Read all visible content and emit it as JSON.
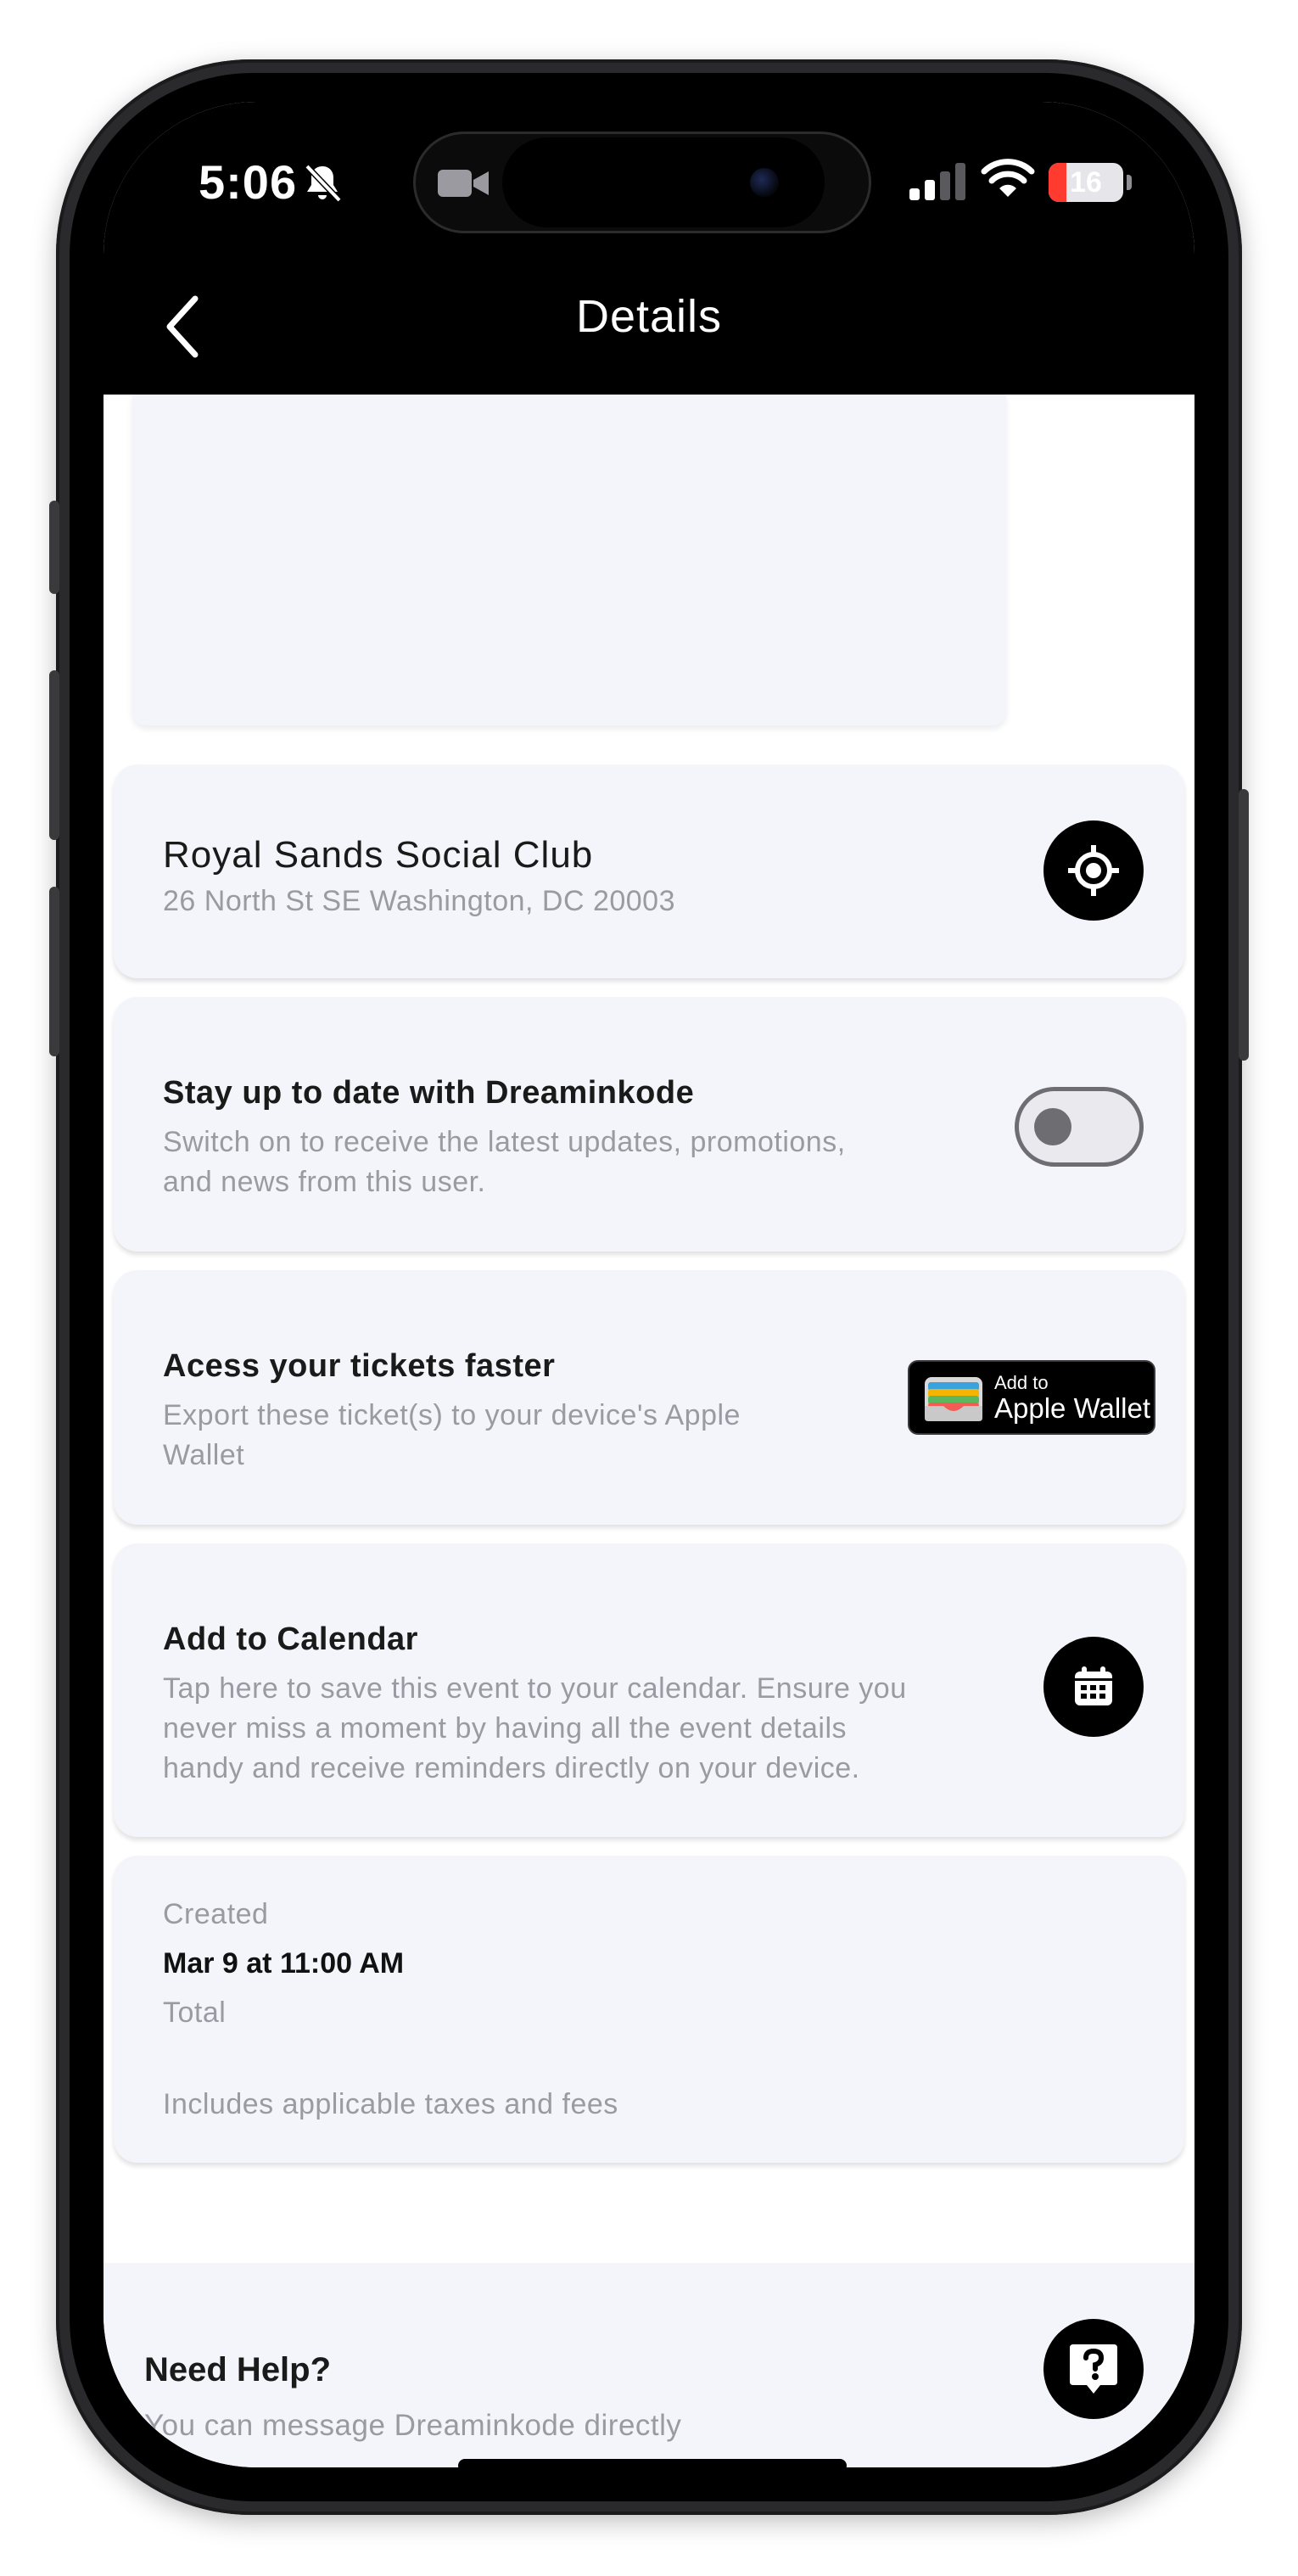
{
  "status_bar": {
    "time": "5:06",
    "battery": "16"
  },
  "header": {
    "title": "Details"
  },
  "venue": {
    "name": "Royal Sands Social Club",
    "address": "26 North St SE Washington, DC 20003"
  },
  "updates": {
    "title": "Stay up to date with Dreaminkode",
    "line1": "Switch on to receive the latest updates, promotions,",
    "line2": "and news from this user.",
    "toggle_on": false
  },
  "wallet": {
    "title": "Acess your tickets faster",
    "line1": "Export these ticket(s) to your device's Apple",
    "line2": "Wallet",
    "button_small": "Add to",
    "button_big": "Apple Wallet"
  },
  "calendar": {
    "title": "Add to Calendar",
    "line1": "Tap here to save this event to your calendar. Ensure you",
    "line2": "never miss a moment by having all the event details",
    "line3": "handy and receive reminders directly on your device."
  },
  "order": {
    "created_label": "Created",
    "created_value": "Mar 9 at 11:00 AM",
    "total_label": "Total",
    "taxes_note": "Includes applicable taxes and fees"
  },
  "help": {
    "title": "Need Help?",
    "subtitle": "You can message Dreaminkode directly"
  },
  "colors": {
    "card_bg": "#f4f5fa",
    "header_bg": "#000000",
    "battery_low": "#ff3b30"
  }
}
